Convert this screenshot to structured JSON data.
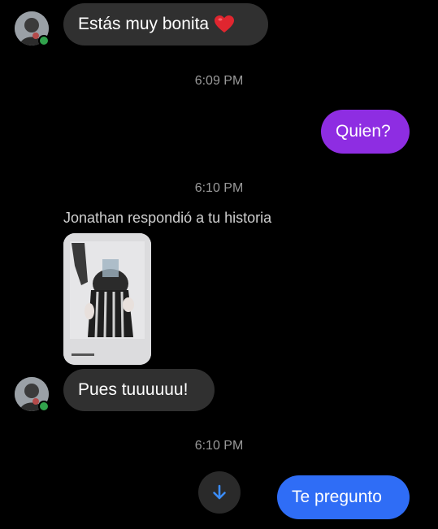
{
  "conversation": {
    "messages": {
      "m1": {
        "text": "Estás muy bonita",
        "emoji": "❤️"
      },
      "m2": {
        "text": "Quien?"
      },
      "m3": {
        "text": "Pues tuuuuuu!"
      },
      "m4": {
        "text": "Te pregunto"
      }
    },
    "timestamps": {
      "t1": "6:09 PM",
      "t2": "6:10 PM",
      "t3": "6:10 PM"
    },
    "story_reply_label": "Jonathan respondió a tu historia",
    "icons": {
      "heart": "heart-emoji",
      "scroll": "arrow-down-icon",
      "online": "online-status-dot"
    }
  },
  "colors": {
    "outgoing_purple": "#8e2de2",
    "outgoing_blue": "#2f6df6",
    "incoming_gray": "#303030",
    "online_green": "#31a24c"
  }
}
